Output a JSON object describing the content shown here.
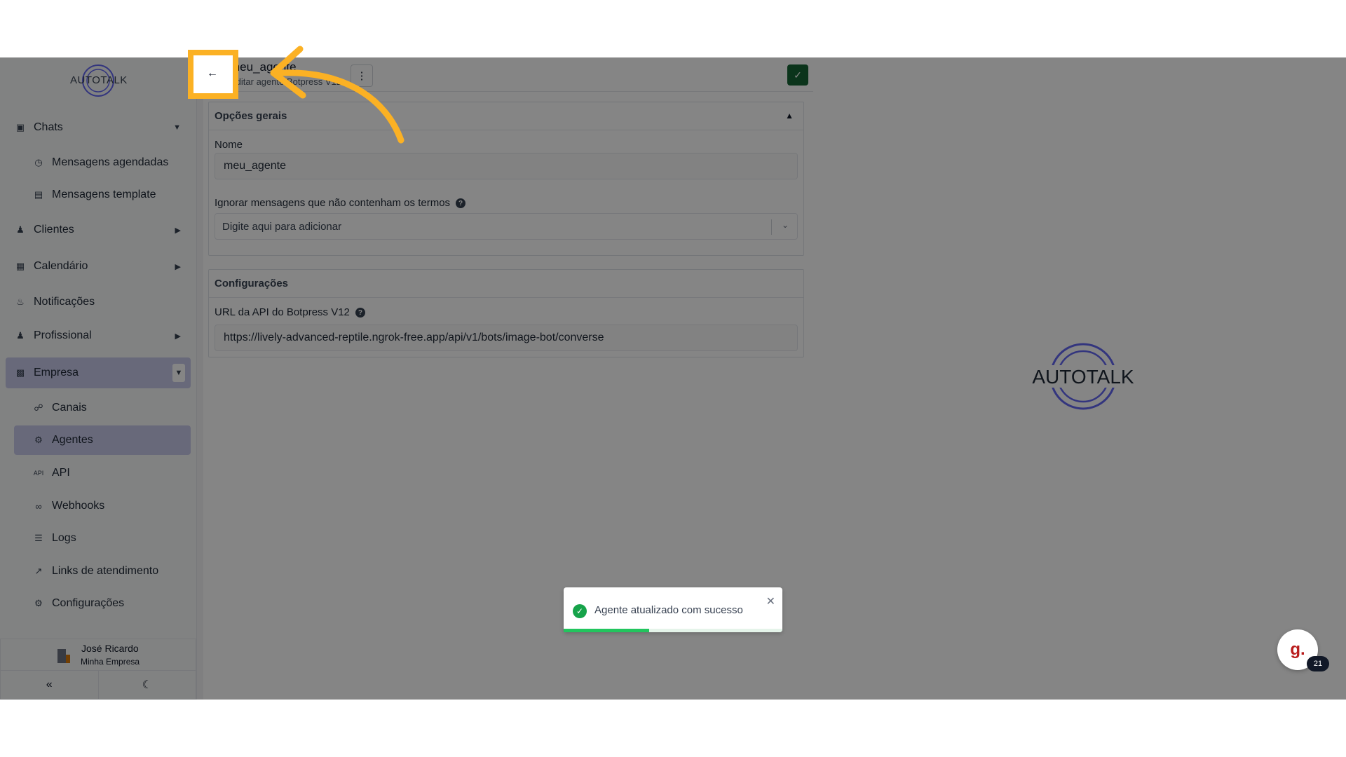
{
  "brand": {
    "logo_text": "AUTOTALK"
  },
  "sidebar": {
    "items": [
      {
        "label": "Chats",
        "icon": "chat-icon",
        "type": "group",
        "caret": "down"
      },
      {
        "label": "Mensagens agendadas",
        "icon": "clock-icon",
        "type": "sub"
      },
      {
        "label": "Mensagens template",
        "icon": "template-icon",
        "type": "sub"
      },
      {
        "label": "Clientes",
        "icon": "users-icon",
        "type": "group",
        "caret": "right"
      },
      {
        "label": "Calendário",
        "icon": "calendar-icon",
        "type": "group",
        "caret": "right"
      },
      {
        "label": "Notificações",
        "icon": "bell-icon",
        "type": "group"
      },
      {
        "label": "Profissional",
        "icon": "professional-icon",
        "type": "group",
        "caret": "right"
      },
      {
        "label": "Empresa",
        "icon": "building-icon",
        "type": "group",
        "caret": "down",
        "active": true
      },
      {
        "label": "Canais",
        "icon": "channels-icon",
        "type": "sub"
      },
      {
        "label": "Agentes",
        "icon": "robot-icon",
        "type": "sub",
        "active": true
      },
      {
        "label": "API",
        "icon": "api-icon",
        "type": "sub"
      },
      {
        "label": "Webhooks",
        "icon": "webhook-icon",
        "type": "sub"
      },
      {
        "label": "Logs",
        "icon": "list-icon",
        "type": "sub"
      },
      {
        "label": "Links de atendimento",
        "icon": "external-link-icon",
        "type": "sub"
      },
      {
        "label": "Configurações",
        "icon": "gear-icon",
        "type": "sub"
      }
    ],
    "user": {
      "name": "José Ricardo",
      "company": "Minha Empresa"
    }
  },
  "header": {
    "title": "meu_agente",
    "subtitle": "Editar agente Botpress V12"
  },
  "general_section": {
    "title": "Opções gerais",
    "name_label": "Nome",
    "name_value": "meu_agente",
    "ignore_label": "Ignorar mensagens que não contenham os termos",
    "ignore_placeholder": "Digite aqui para adicionar"
  },
  "config_section": {
    "title": "Configurações",
    "url_label": "URL da API do Botpress V12",
    "url_value": "https://lively-advanced-reptile.ngrok-free.app/api/v1/bots/image-bot/converse"
  },
  "toast": {
    "message": "Agente atualizado com sucesso",
    "progress": 0.39
  },
  "support_chat": {
    "icon_letter": "g.",
    "badge": "21"
  },
  "colors": {
    "accent": "#c7c9ea",
    "success": "#16a34a",
    "highlight": "#fbb124",
    "save": "#166534"
  }
}
